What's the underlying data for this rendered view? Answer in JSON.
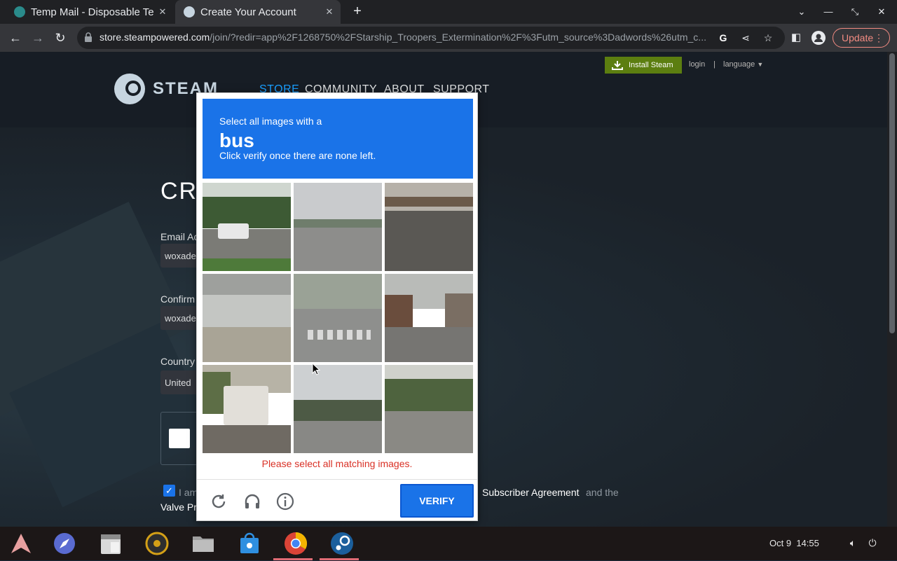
{
  "browser": {
    "tabs": [
      {
        "title": "Temp Mail - Disposable Te",
        "active": false
      },
      {
        "title": "Create Your Account",
        "active": true
      }
    ],
    "new_tab_label": "+",
    "url_host": "store.steampowered.com",
    "url_path": "/join/?redir=app%2F1268750%2FStarship_Troopers_Extermination%2F%3Futm_source%3Dadwords%26utm_c...",
    "update_label": "Update"
  },
  "steam": {
    "logo_text": "STEAM",
    "nav": [
      "STORE",
      "COMMUNITY",
      "ABOUT",
      "SUPPORT"
    ],
    "install_label": "Install Steam",
    "login_label": "login",
    "separator": "|",
    "language_label": "language",
    "form": {
      "title_partial": "CRI",
      "email_label_partial": "Email Ac",
      "email_value_partial": "woxade",
      "confirm_label_partial": "Confirm",
      "confirm_value_partial": "woxade",
      "country_label_partial": "Country",
      "country_value_partial": "United",
      "agree_prefix": "I am",
      "agree_link": "Subscriber Agreement",
      "agree_mid": "and the",
      "agree_second_line_partial": "Valve Pr"
    }
  },
  "captcha": {
    "instruction": "Select all images with a",
    "object": "bus",
    "sub_instruction": "Click verify once there are none left.",
    "error": "Please select all matching images.",
    "verify_label": "VERIFY",
    "tiles": [
      {
        "name": "tile-white-truck-road"
      },
      {
        "name": "tile-intersection-crosswalk"
      },
      {
        "name": "tile-highway-overpass"
      },
      {
        "name": "tile-beach-underpass"
      },
      {
        "name": "tile-pedestrians-crosswalk"
      },
      {
        "name": "tile-town-street"
      },
      {
        "name": "tile-white-bus"
      },
      {
        "name": "tile-street-palm-trees"
      },
      {
        "name": "tile-suburban-road"
      }
    ]
  },
  "taskbar": {
    "date": "Oct 9",
    "time": "14:55"
  }
}
